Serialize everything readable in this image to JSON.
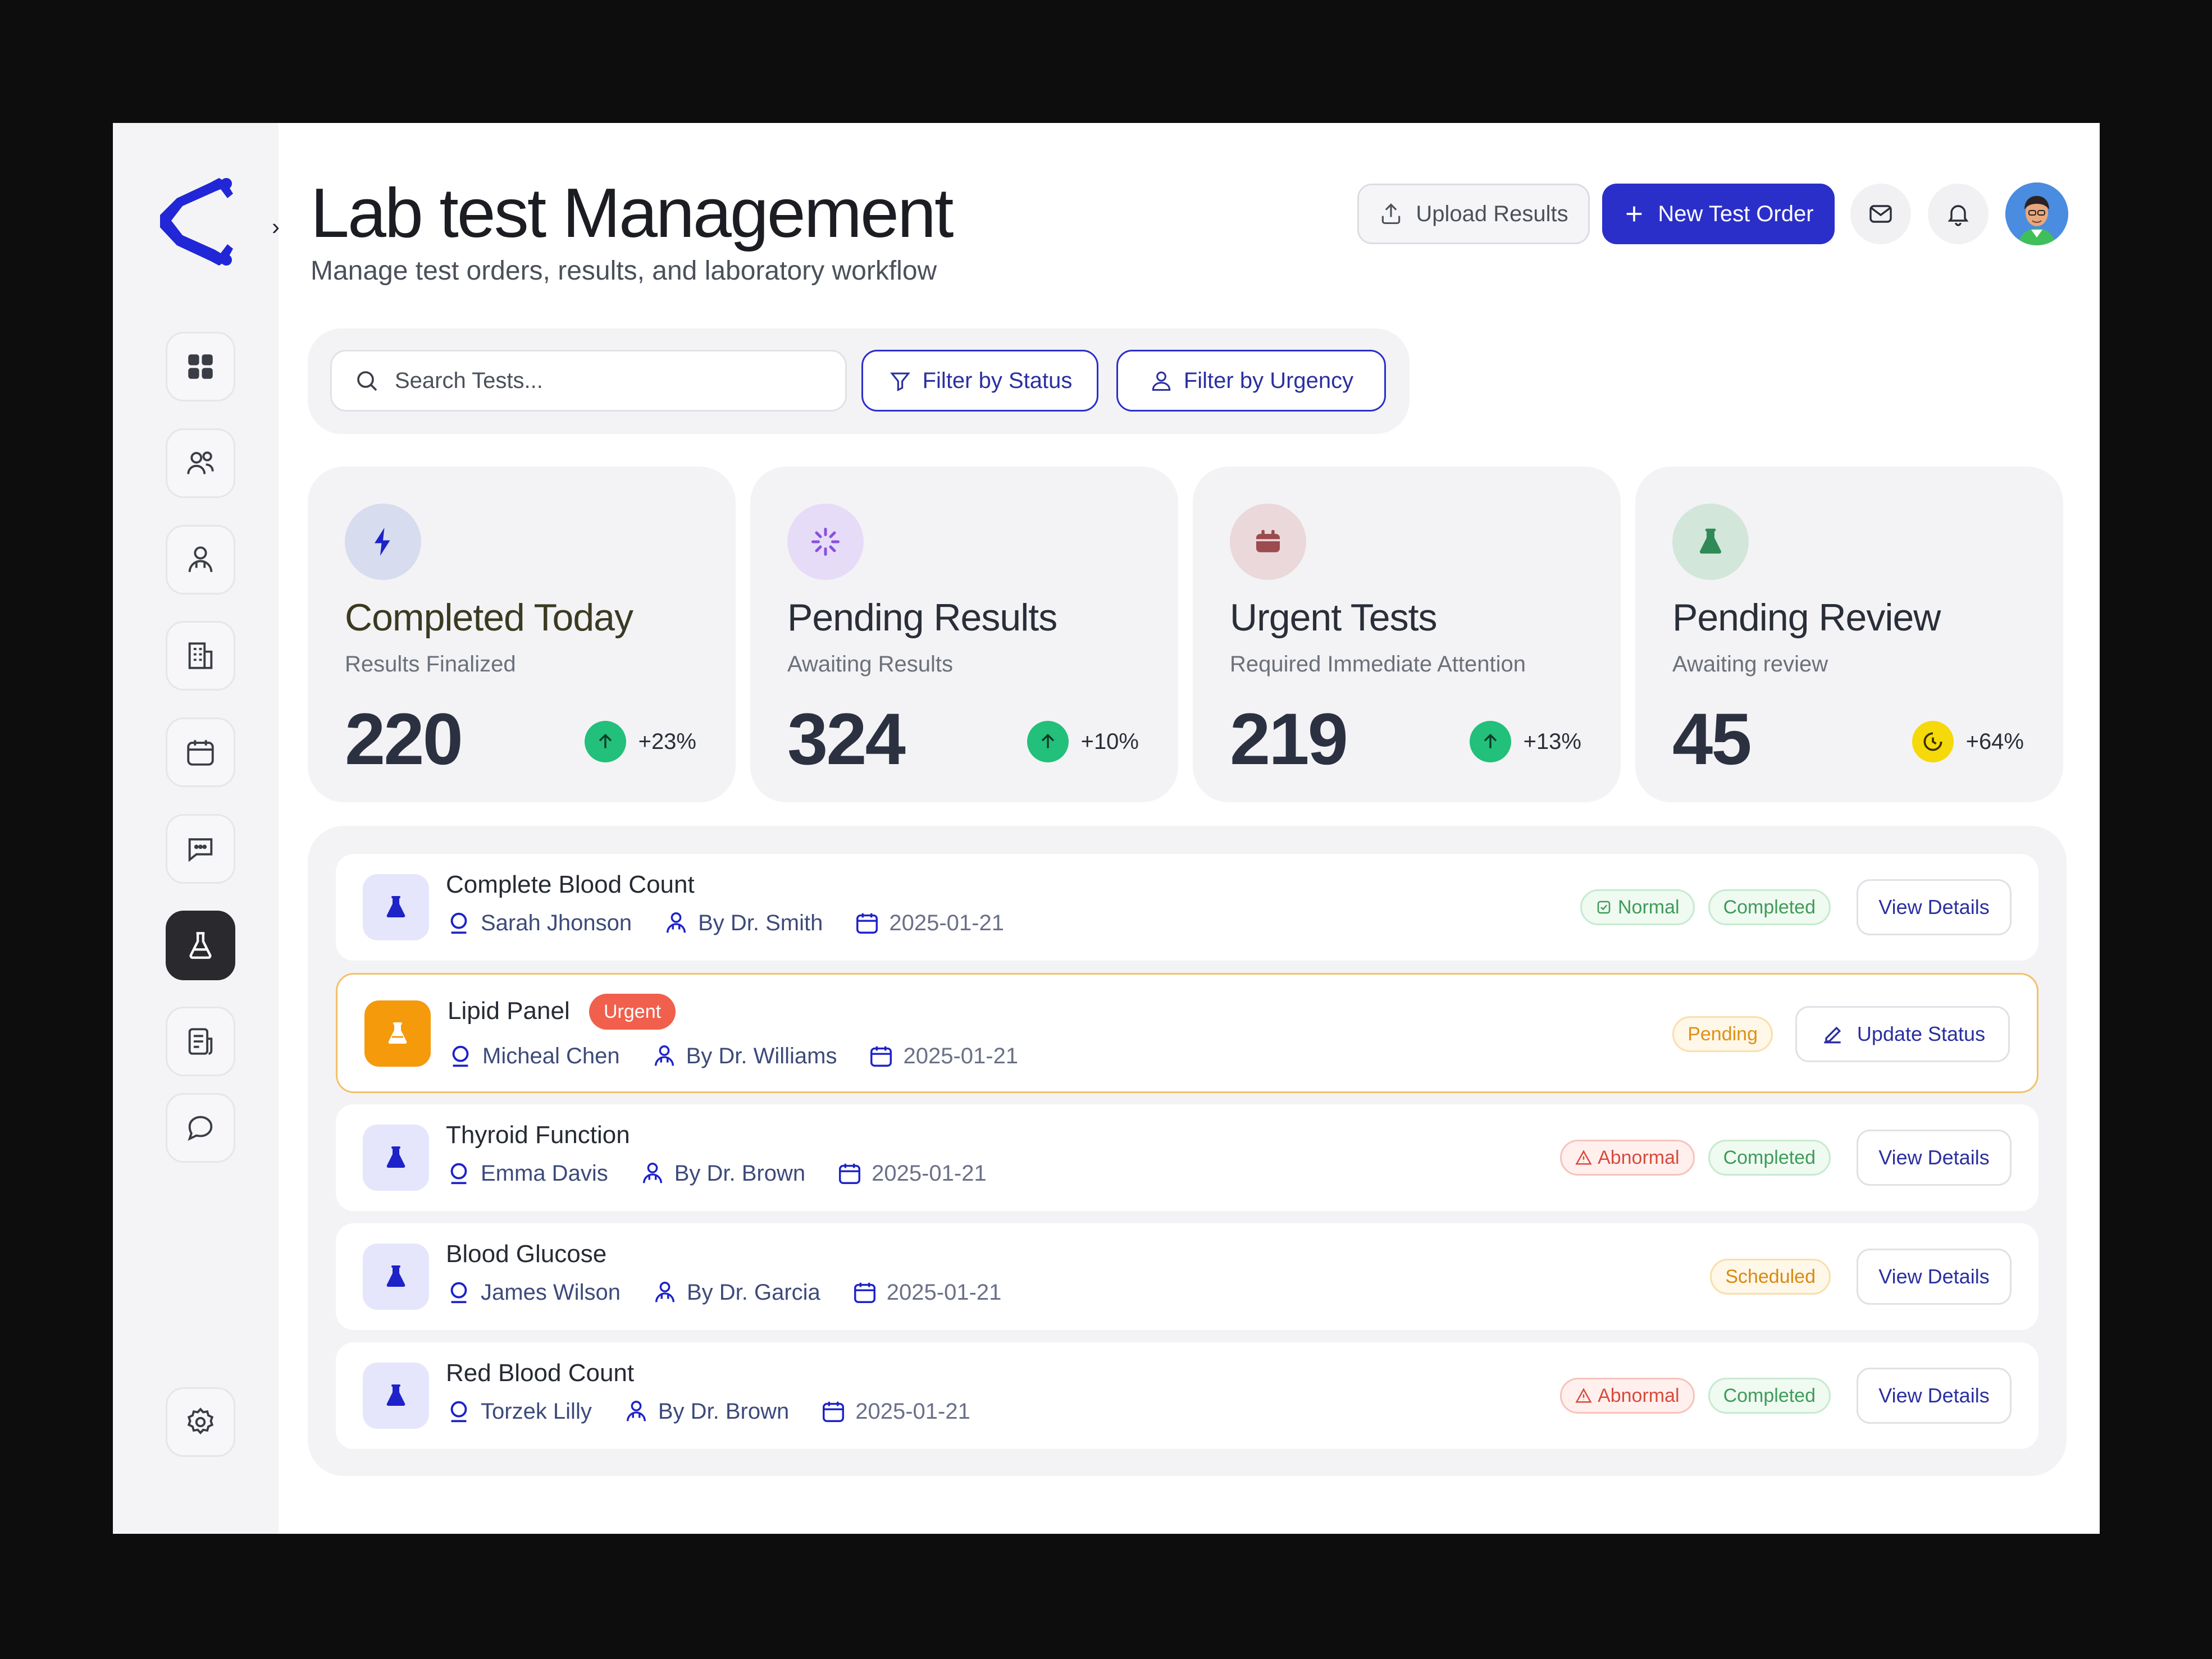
{
  "header": {
    "title": "Lab test Management",
    "subtitle": "Manage test orders, results, and laboratory workflow",
    "upload_label": "Upload Results",
    "new_order_label": "New Test Order"
  },
  "sidebar": {
    "items": [
      {
        "icon": "grid-icon"
      },
      {
        "icon": "users-icon"
      },
      {
        "icon": "doctor-icon"
      },
      {
        "icon": "building-icon"
      },
      {
        "icon": "calendar-icon"
      },
      {
        "icon": "chat-icon"
      },
      {
        "icon": "flask-icon",
        "active": true
      },
      {
        "icon": "report-icon"
      },
      {
        "icon": "message-icon"
      }
    ],
    "settings_icon": "gear-icon"
  },
  "search": {
    "placeholder": "Search Tests...",
    "filter_status": "Filter by Status",
    "filter_urgency": "Filter by Urgency"
  },
  "stats": [
    {
      "title": "Completed Today",
      "subtitle": "Results Finalized",
      "value": "220",
      "change": "+23%",
      "icon": "bolt-icon",
      "icon_bg": "#d7dcef",
      "icon_color": "#1d22c9",
      "trend_color": "#22c07a"
    },
    {
      "title": "Pending Results",
      "subtitle": "Awaiting Results",
      "value": "324",
      "change": "+10%",
      "icon": "loader-icon",
      "icon_bg": "#e6dcf7",
      "icon_color": "#8a4fe0",
      "trend_color": "#22c07a"
    },
    {
      "title": "Urgent Tests",
      "subtitle": "Required Immediate Attention",
      "value": "219",
      "change": "+13%",
      "icon": "calendar-icon",
      "icon_bg": "#ead8da",
      "icon_color": "#9c4b4f",
      "trend_color": "#22c07a"
    },
    {
      "title": "Pending Review",
      "subtitle": "Awaiting review",
      "value": "45",
      "change": "+64%",
      "icon": "flask-icon",
      "icon_bg": "#d2e6da",
      "icon_color": "#2f8a55",
      "trend_color": "#f5d90a"
    }
  ],
  "tests": [
    {
      "name": "Complete Blood Count",
      "patient": "Sarah Jhonson",
      "doctor": "By Dr. Smith",
      "date": "2025-01-21",
      "badges": [
        {
          "label": "Normal",
          "kind": "normal"
        },
        {
          "label": "Completed",
          "kind": "completed"
        }
      ],
      "action": "View Details"
    },
    {
      "name": "Lipid Panel",
      "urgent_tag": "Urgent",
      "patient": "Micheal Chen",
      "doctor": "By Dr. Williams",
      "date": "2025-01-21",
      "badges": [
        {
          "label": "Pending",
          "kind": "pending"
        }
      ],
      "action": "Update Status"
    },
    {
      "name": "Thyroid Function",
      "patient": "Emma Davis",
      "doctor": "By Dr. Brown",
      "date": "2025-01-21",
      "badges": [
        {
          "label": "Abnormal",
          "kind": "abnormal"
        },
        {
          "label": "Completed",
          "kind": "completed"
        }
      ],
      "action": "View Details"
    },
    {
      "name": "Blood Glucose",
      "patient": "James Wilson",
      "doctor": "By Dr. Garcia",
      "date": "2025-01-21",
      "badges": [
        {
          "label": "Scheduled",
          "kind": "scheduled"
        }
      ],
      "action": "View Details"
    },
    {
      "name": "Red Blood Count",
      "patient": "Torzek Lilly",
      "doctor": "By Dr. Brown",
      "date": "2025-01-21",
      "badges": [
        {
          "label": "Abnormal",
          "kind": "abnormal"
        },
        {
          "label": "Completed",
          "kind": "completed"
        }
      ],
      "action": "View Details"
    }
  ]
}
